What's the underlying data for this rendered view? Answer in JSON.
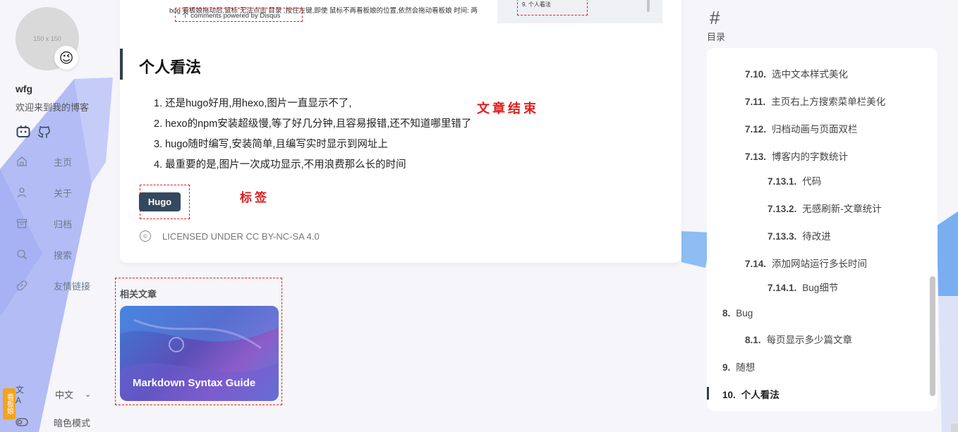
{
  "sidebar": {
    "avatar_placeholder": "150 x 150",
    "avatar_emoji": "😉",
    "site_name": "wfg",
    "site_desc": "欢迎来到我的博客",
    "nav": [
      {
        "label": "主页",
        "icon": "home-icon"
      },
      {
        "label": "关于",
        "icon": "user-icon"
      },
      {
        "label": "归档",
        "icon": "archive-icon"
      },
      {
        "label": "搜索",
        "icon": "search-icon"
      },
      {
        "label": "友情链接",
        "icon": "link-icon"
      }
    ],
    "language": "中文",
    "dark_mode": "暗色模式",
    "kanban_tab": "看板娘"
  },
  "article": {
    "screenshot_line1": "bug 看板娘拖动后,鼠标 无法点击 目录 ,按住左键,即使 鼠标不再看板娘的位置,依然会拖动看板娘 时间: 两",
    "screenshot_line2": "个 comments powered by Disqus",
    "screenshot_toc": "9. 个人看法",
    "heading": "个人看法",
    "list": [
      "1. 还是hugo好用,用hexo,图片一直显示不了,",
      "2. hexo的npm安装超级慢,等了好几分钟,且容易报错,还不知道哪里错了",
      "3. hugo随时编写,安装简单,且编写实时显示到网址上",
      "4. 最重要的是,图片一次成功显示,不用浪费那么长的时间"
    ],
    "annotation_end": "文章结束",
    "annotation_tag": "标签",
    "tag": "Hugo",
    "license_icon": "©",
    "license": "LICENSED UNDER CC BY-NC-SA 4.0"
  },
  "related": {
    "title": "相关文章",
    "card_title": "Markdown Syntax Guide"
  },
  "toc": {
    "hash": "#",
    "label": "目录",
    "items": [
      {
        "num": "7.10.",
        "text": "选中文本样式美化"
      },
      {
        "num": "7.11.",
        "text": "主页右上方搜索菜单栏美化"
      },
      {
        "num": "7.12.",
        "text": "归档动画与页面双栏"
      },
      {
        "num": "7.13.",
        "text": "博客内的字数统计"
      },
      {
        "num": "7.13.1.",
        "text": "代码"
      },
      {
        "num": "7.13.2.",
        "text": "无感刷新-文章统计"
      },
      {
        "num": "7.13.3.",
        "text": "待改进"
      },
      {
        "num": "7.14.",
        "text": "添加网站运行多长时间"
      },
      {
        "num": "7.14.1.",
        "text": "Bug细节"
      },
      {
        "num": "8.",
        "text": "Bug"
      },
      {
        "num": "8.1.",
        "text": "每页显示多少篇文章"
      },
      {
        "num": "9.",
        "text": "随想"
      },
      {
        "num": "10.",
        "text": "个人看法"
      }
    ]
  },
  "colors": {
    "accent_dark": "#34495e",
    "annotation_red": "#e31b1b",
    "kanban_orange": "#f3a31d"
  }
}
